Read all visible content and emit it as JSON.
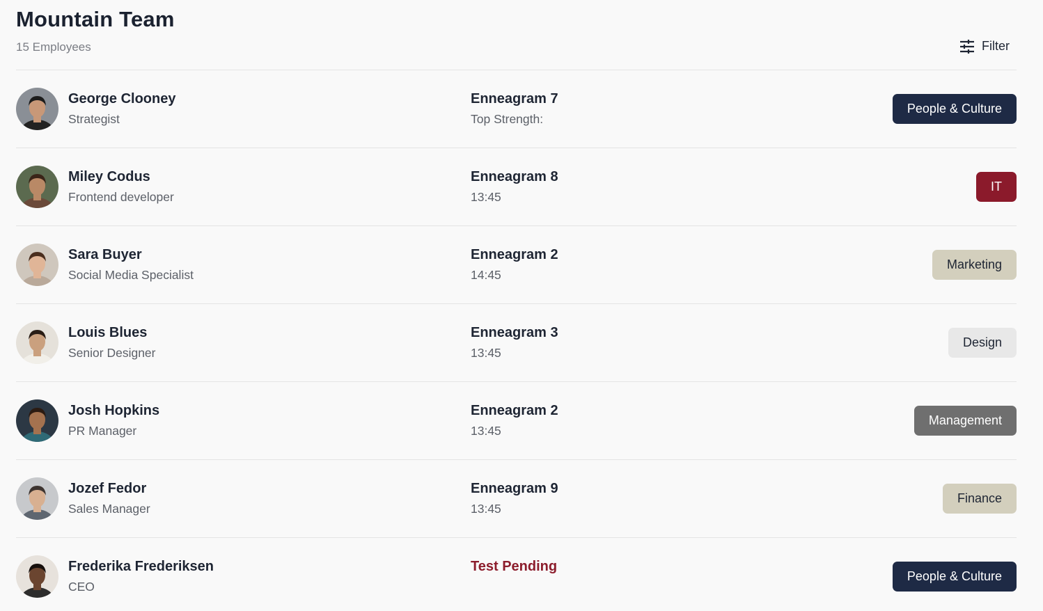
{
  "header": {
    "title": "Mountain Team",
    "subtitle": "15 Employees",
    "filter_label": "Filter"
  },
  "employees": [
    {
      "name": "George Clooney",
      "role": "Strategist",
      "enneagram": "Enneagram 7",
      "meta": "Top Strength:",
      "department": "People & Culture",
      "dept_class": "dept-people"
    },
    {
      "name": "Miley Codus",
      "role": "Frontend developer",
      "enneagram": "Enneagram 8",
      "meta": "13:45",
      "department": "IT",
      "dept_class": "dept-it"
    },
    {
      "name": "Sara Buyer",
      "role": "Social Media Specialist",
      "enneagram": "Enneagram 2",
      "meta": "14:45",
      "department": "Marketing",
      "dept_class": "dept-marketing"
    },
    {
      "name": "Louis Blues",
      "role": "Senior Designer",
      "enneagram": "Enneagram 3",
      "meta": "13:45",
      "department": "Design",
      "dept_class": "dept-design"
    },
    {
      "name": "Josh Hopkins",
      "role": "PR Manager",
      "enneagram": "Enneagram 2",
      "meta": "13:45",
      "department": "Management",
      "dept_class": "dept-management"
    },
    {
      "name": "Jozef Fedor",
      "role": "Sales Manager",
      "enneagram": "Enneagram 9",
      "meta": "13:45",
      "department": "Finance",
      "dept_class": "dept-finance"
    },
    {
      "name": "Frederika Frederiksen",
      "role": "CEO",
      "enneagram": "Test Pending",
      "meta": "",
      "department": "People & Culture",
      "dept_class": "dept-people"
    }
  ],
  "colors": {
    "navy": "#1e2a45",
    "crimson": "#8b1a2b",
    "sand": "#d3cfbd",
    "light_gray": "#e8e8e8",
    "dark_gray": "#6f6f6f",
    "pending_text": "#8c1d2c"
  },
  "icons": {
    "filter": "sliders-icon",
    "avatar": "person-photo"
  }
}
